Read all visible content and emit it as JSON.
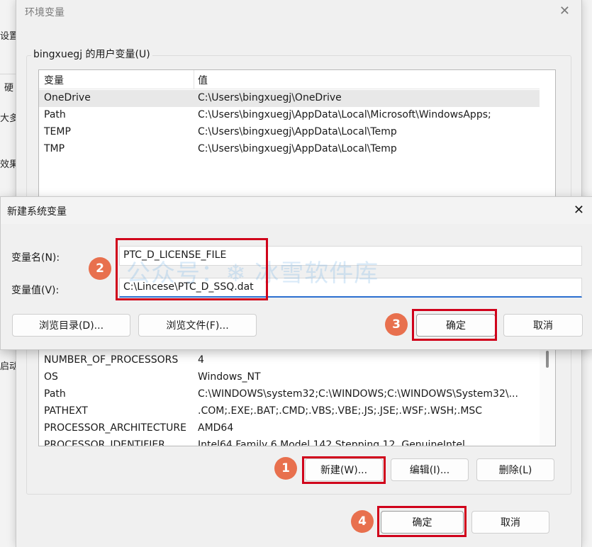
{
  "background_window": {
    "fragments": [
      "设置",
      "硬",
      "大多",
      "效果",
      "启动"
    ]
  },
  "env_dialog": {
    "title": "环境变量",
    "close_icon": "close-icon",
    "user_group_label": "bingxuegj 的用户变量(U)",
    "user_columns": [
      "变量",
      "值"
    ],
    "user_vars": [
      {
        "name": "OneDrive",
        "value": "C:\\Users\\bingxuegj\\OneDrive"
      },
      {
        "name": "Path",
        "value": "C:\\Users\\bingxuegj\\AppData\\Local\\Microsoft\\WindowsApps;"
      },
      {
        "name": "TEMP",
        "value": "C:\\Users\\bingxuegj\\AppData\\Local\\Temp"
      },
      {
        "name": "TMP",
        "value": "C:\\Users\\bingxuegj\\AppData\\Local\\Temp"
      }
    ],
    "system_vars": [
      {
        "name": "NUMBER_OF_PROCESSORS",
        "value": "4"
      },
      {
        "name": "OS",
        "value": "Windows_NT"
      },
      {
        "name": "Path",
        "value": "C:\\WINDOWS\\system32;C:\\WINDOWS;C:\\WINDOWS\\System32\\..."
      },
      {
        "name": "PATHEXT",
        "value": ".COM;.EXE;.BAT;.CMD;.VBS;.VBE;.JS;.JSE;.WSF;.WSH;.MSC"
      },
      {
        "name": "PROCESSOR_ARCHITECTURE",
        "value": "AMD64"
      },
      {
        "name": "PROCESSOR_IDENTIFIER",
        "value": "Intel64 Family 6 Model 142 Stepping 12, GenuineIntel"
      }
    ],
    "sys_buttons": {
      "new": "新建(W)...",
      "edit": "编辑(I)...",
      "delete": "删除(L)"
    },
    "ok": "确定",
    "cancel": "取消"
  },
  "new_var_dialog": {
    "title": "新建系统变量",
    "name_label": "变量名(N):",
    "name_value": "PTC_D_LICENSE_FILE",
    "value_label": "变量值(V):",
    "value_value": "C:\\Lincese\\PTC_D_SSQ.dat",
    "browse_dir": "浏览目录(D)...",
    "browse_file": "浏览文件(F)...",
    "ok": "确定",
    "cancel": "取消"
  },
  "watermark": "公众号：❄ 冰雪软件库",
  "step_badges": [
    "1",
    "2",
    "3",
    "4"
  ],
  "colors": {
    "highlight": "#d0021b",
    "badge": "#e8704e",
    "focus_underline": "#2b6fd0"
  }
}
